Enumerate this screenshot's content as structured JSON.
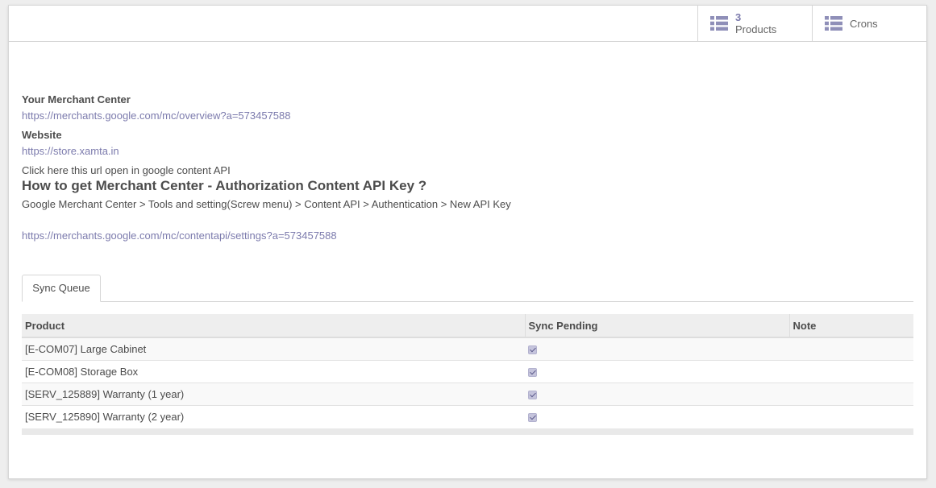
{
  "stat_buttons": {
    "products": {
      "count": "3",
      "label": "Products",
      "icon": "list-icon"
    },
    "crons": {
      "label": "Crons",
      "icon": "list-icon"
    }
  },
  "info": {
    "merchant_center_label": "Your Merchant Center",
    "merchant_center_url": "https://merchants.google.com/mc/overview?a=573457588",
    "website_label": "Website",
    "website_url": "https://store.xamta.in",
    "click_here_text": "Click here this url open in google content API",
    "heading": "How to get Merchant Center - Authorization Content API Key ?",
    "path_text": "Google Merchant Center > Tools and setting(Screw menu) > Content API > Authentication > New API Key",
    "content_api_url": "https://merchants.google.com/mc/contentapi/settings?a=573457588"
  },
  "tabs": [
    {
      "label": "Sync Queue"
    }
  ],
  "table": {
    "headers": [
      "Product",
      "Sync Pending",
      "Note"
    ],
    "rows": [
      {
        "product": "[E-COM07] Large Cabinet",
        "sync_pending": true,
        "note": ""
      },
      {
        "product": "[E-COM08] Storage Box",
        "sync_pending": true,
        "note": ""
      },
      {
        "product": "[SERV_125889] Warranty (1 year)",
        "sync_pending": true,
        "note": ""
      },
      {
        "product": "[SERV_125890] Warranty (2 year)",
        "sync_pending": true,
        "note": ""
      }
    ]
  },
  "colors": {
    "accent": "#7c7bad",
    "text": "#4c4c4c",
    "header_bg": "#eeeeee"
  }
}
